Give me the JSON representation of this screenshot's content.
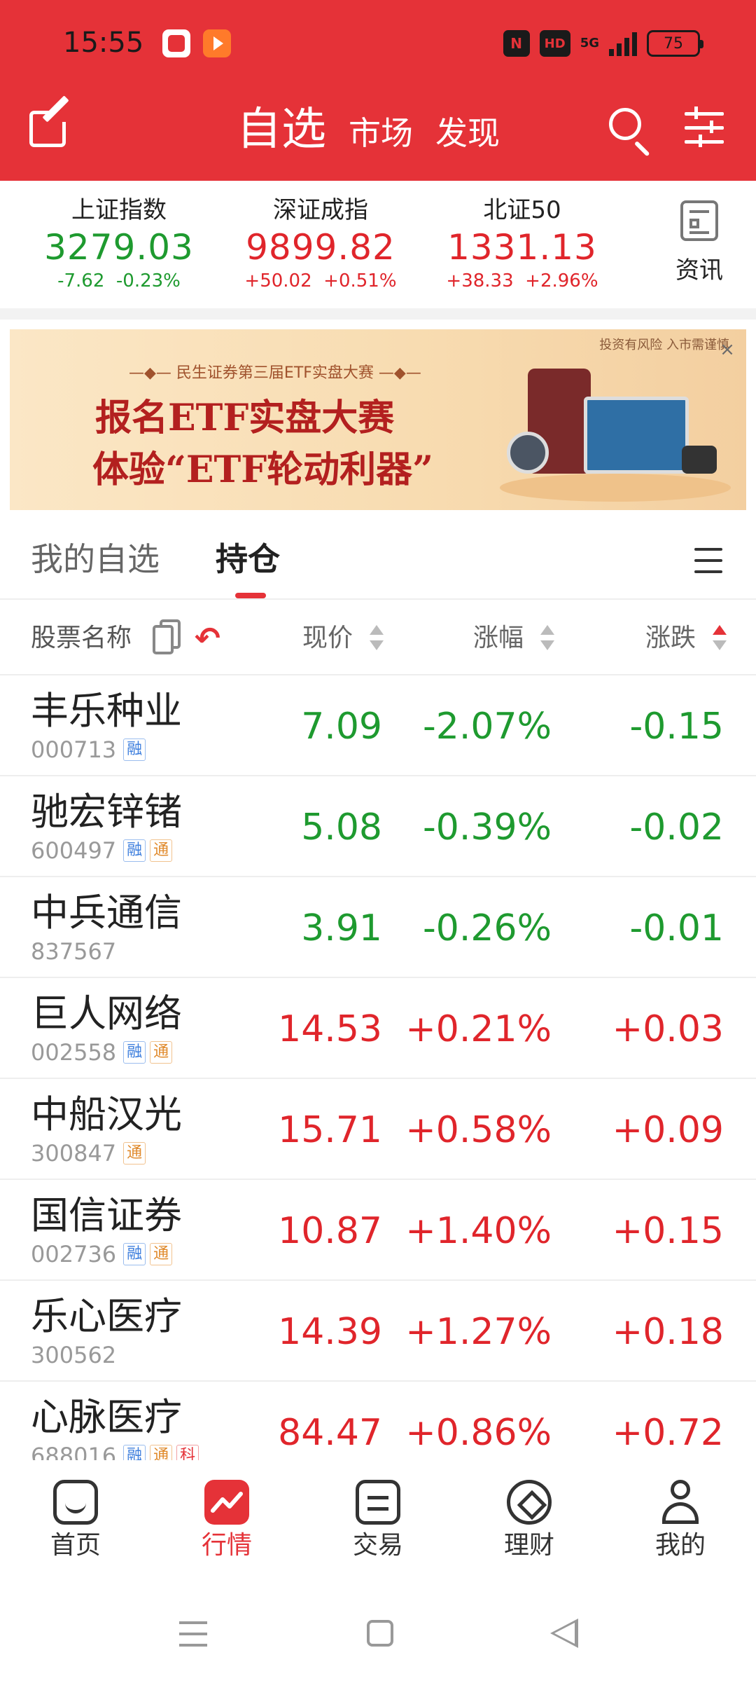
{
  "status_bar": {
    "time": "15:55",
    "nfc": "N",
    "hd": "HD",
    "network": "5G",
    "battery": "75"
  },
  "header": {
    "tabs": [
      "自选",
      "市场",
      "发现"
    ],
    "active_tab": "自选",
    "accent_color": "#e53238"
  },
  "indices": [
    {
      "name": "上证指数",
      "value": "3279.03",
      "change": "-7.62",
      "pct": "-0.23%",
      "direction": "down"
    },
    {
      "name": "深证成指",
      "value": "9899.82",
      "change": "+50.02",
      "pct": "+0.51%",
      "direction": "up"
    },
    {
      "name": "北证50",
      "value": "1331.13",
      "change": "+38.33",
      "pct": "+2.96%",
      "direction": "up"
    }
  ],
  "news_label": "资讯",
  "banner": {
    "subtitle": "—◆— 民生证券第三届ETF实盘大赛 —◆—",
    "line1": "报名ETF实盘大赛",
    "line2": "体验“ETF轮动利器”",
    "risk_note": "投资有风险 入市需谨慎",
    "close": "×"
  },
  "sub_tabs": {
    "mine": "我的自选",
    "holdings": "持仓",
    "active": "持仓"
  },
  "columns": {
    "name": "股票名称",
    "price": "现价",
    "pct": "涨幅",
    "change": "涨跌",
    "sorted_by": "涨跌"
  },
  "stocks": [
    {
      "name": "丰乐种业",
      "code": "000713",
      "tags": [
        "融"
      ],
      "price": "7.09",
      "pct": "-2.07%",
      "change": "-0.15",
      "direction": "down"
    },
    {
      "name": "驰宏锌锗",
      "code": "600497",
      "tags": [
        "融",
        "通"
      ],
      "price": "5.08",
      "pct": "-0.39%",
      "change": "-0.02",
      "direction": "down"
    },
    {
      "name": "中兵通信",
      "code": "837567",
      "tags": [],
      "price": "3.91",
      "pct": "-0.26%",
      "change": "-0.01",
      "direction": "down"
    },
    {
      "name": "巨人网络",
      "code": "002558",
      "tags": [
        "融",
        "通"
      ],
      "price": "14.53",
      "pct": "+0.21%",
      "change": "+0.03",
      "direction": "up"
    },
    {
      "name": "中船汉光",
      "code": "300847",
      "tags": [
        "通"
      ],
      "price": "15.71",
      "pct": "+0.58%",
      "change": "+0.09",
      "direction": "up"
    },
    {
      "name": "国信证券",
      "code": "002736",
      "tags": [
        "融",
        "通"
      ],
      "price": "10.87",
      "pct": "+1.40%",
      "change": "+0.15",
      "direction": "up"
    },
    {
      "name": "乐心医疗",
      "code": "300562",
      "tags": [],
      "price": "14.39",
      "pct": "+1.27%",
      "change": "+0.18",
      "direction": "up"
    },
    {
      "name": "心脉医疗",
      "code": "688016",
      "tags": [
        "融",
        "通",
        "科"
      ],
      "price": "84.47",
      "pct": "+0.86%",
      "change": "+0.72",
      "direction": "up"
    }
  ],
  "bottom_nav": [
    {
      "label": "首页",
      "icon": "home-icon"
    },
    {
      "label": "行情",
      "icon": "market-icon",
      "active": true
    },
    {
      "label": "交易",
      "icon": "trade-icon"
    },
    {
      "label": "理财",
      "icon": "finance-icon"
    },
    {
      "label": "我的",
      "icon": "profile-icon"
    }
  ],
  "colors": {
    "up": "#e0252b",
    "down": "#1e9a2f"
  }
}
